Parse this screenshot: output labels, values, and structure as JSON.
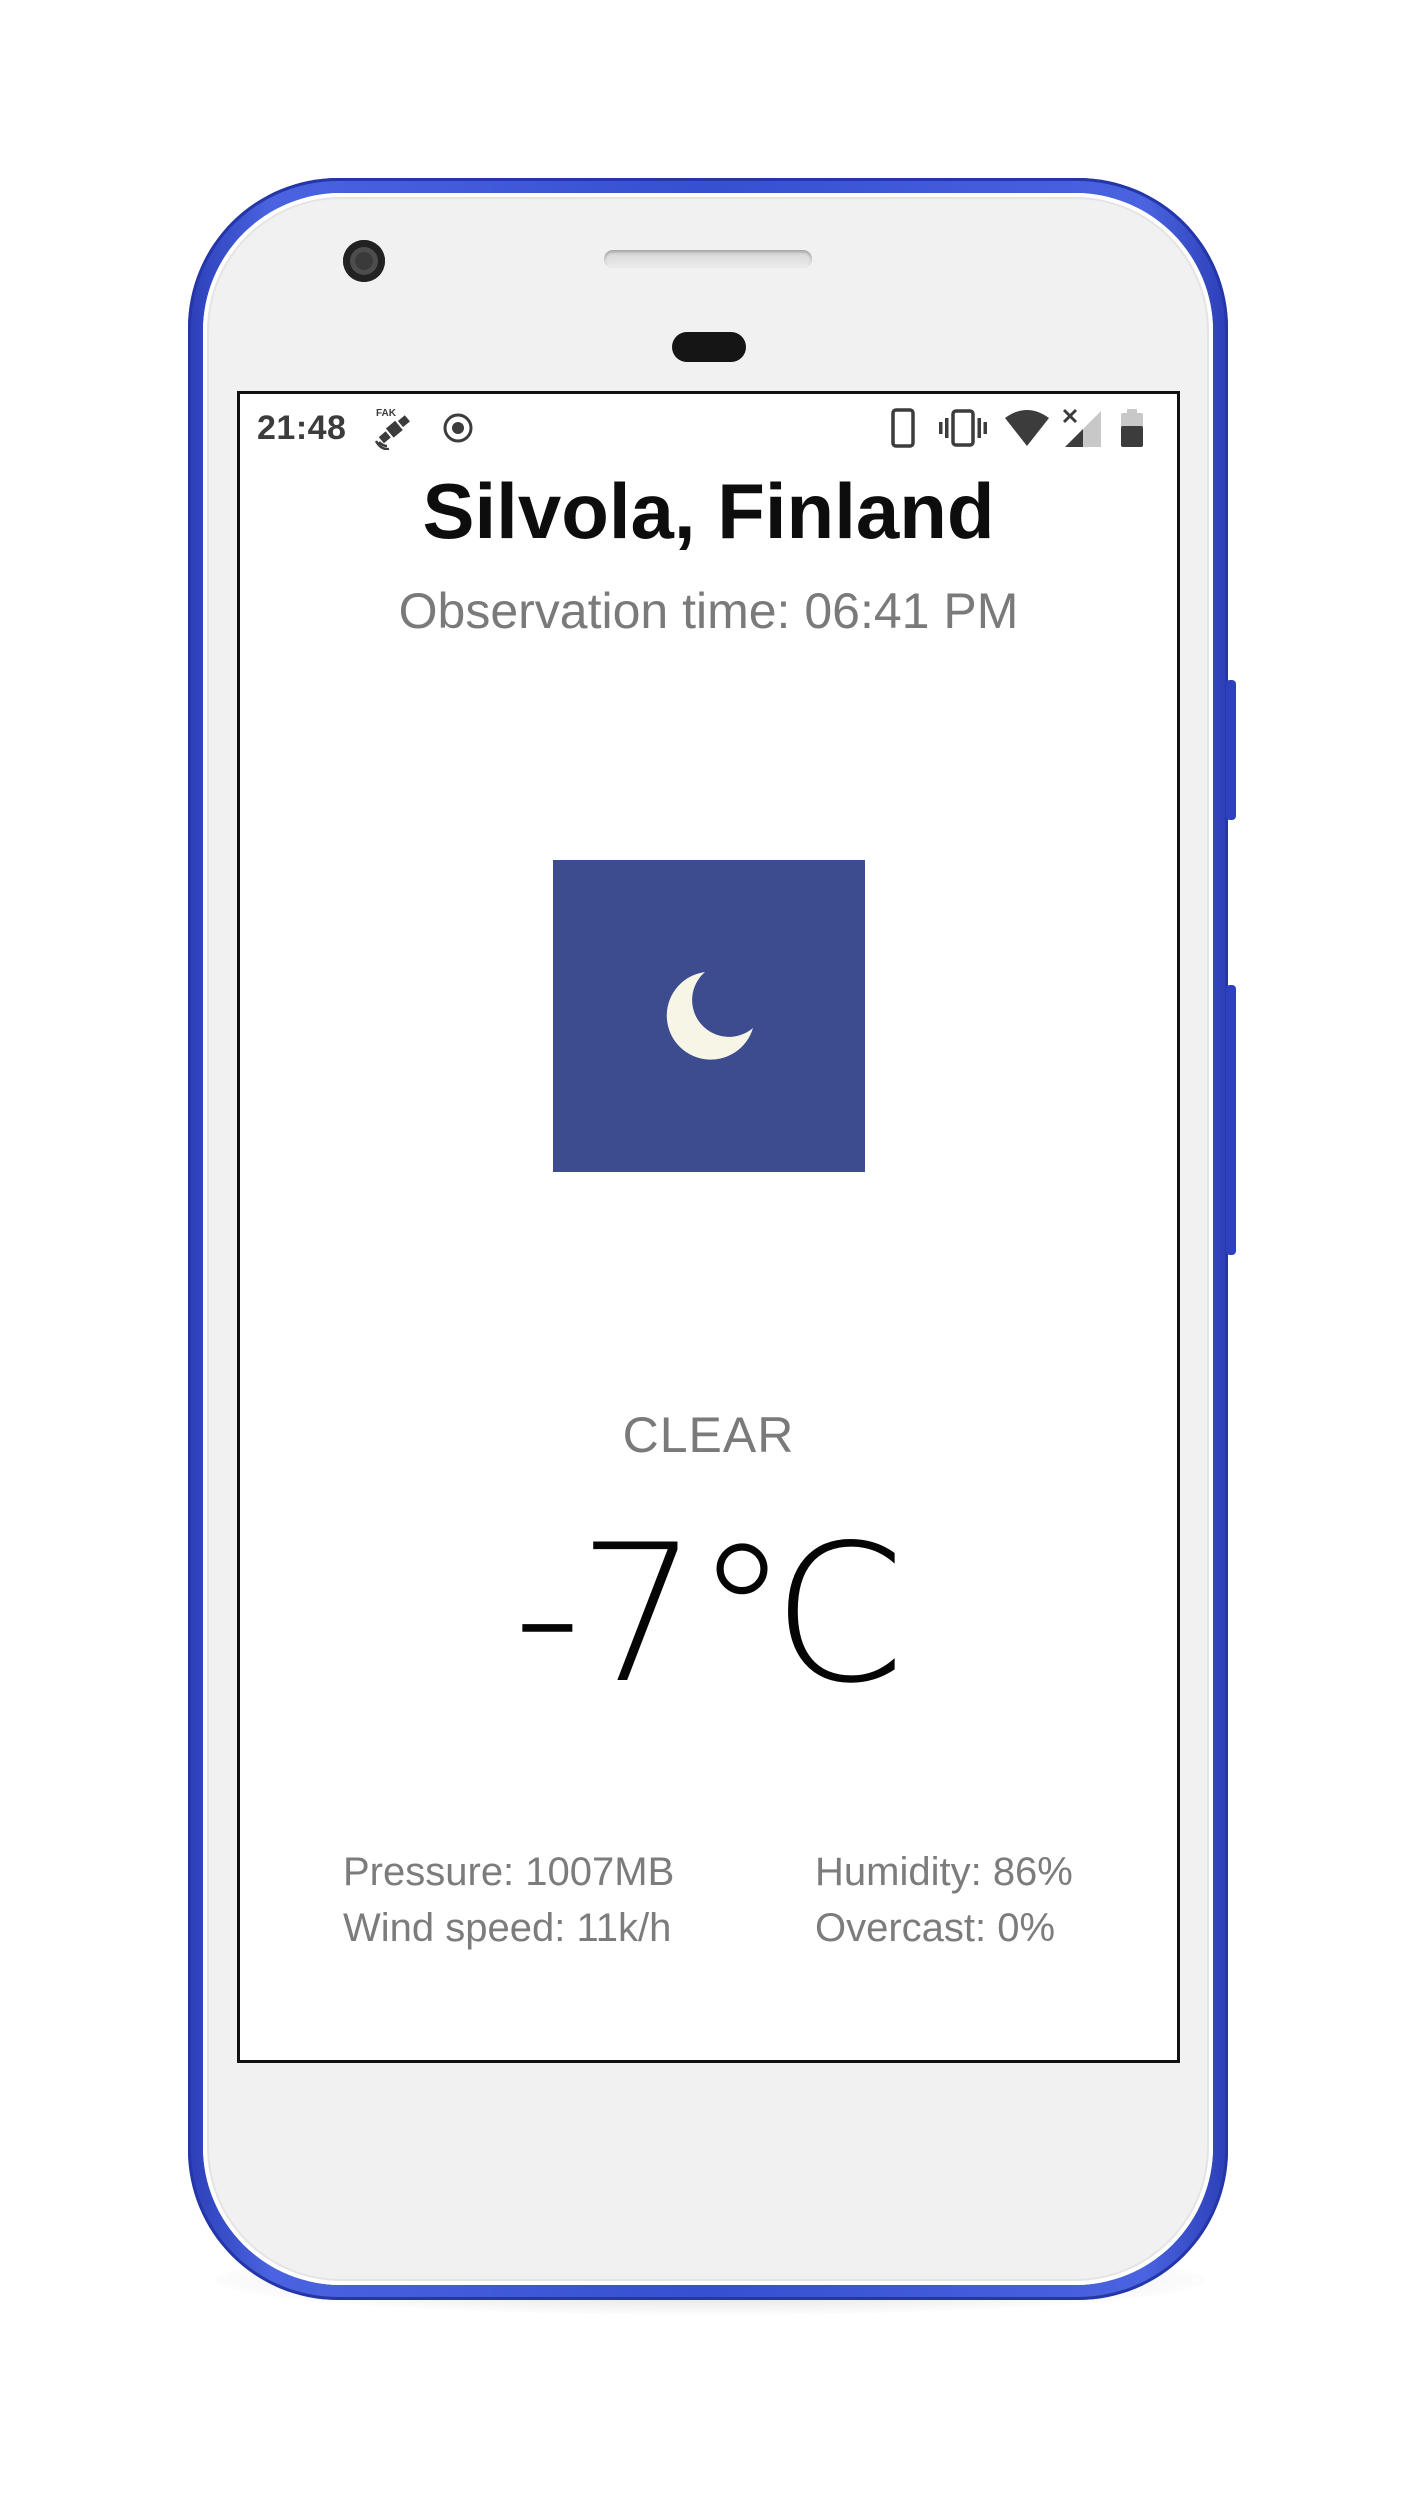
{
  "status_bar": {
    "time": "21:48",
    "icons": [
      "fake-gps-icon",
      "record-icon",
      "phone-icon",
      "vibrate-icon",
      "wifi-icon",
      "no-signal-icon",
      "battery-icon"
    ]
  },
  "weather": {
    "location": "Silvola, Finland",
    "observation_time": "Observation time: 06:41 PM",
    "icon": "moon-icon",
    "icon_bg": "#3c4c8f",
    "condition": "CLEAR",
    "temperature": "-7℃",
    "details": {
      "pressure": "Pressure: 1007MB",
      "wind_speed": "Wind speed: 11k/h",
      "humidity": "Humidity: 86%",
      "overcast": "Overcast: 0%"
    }
  },
  "device": {
    "frame_color": "#3550d0"
  }
}
